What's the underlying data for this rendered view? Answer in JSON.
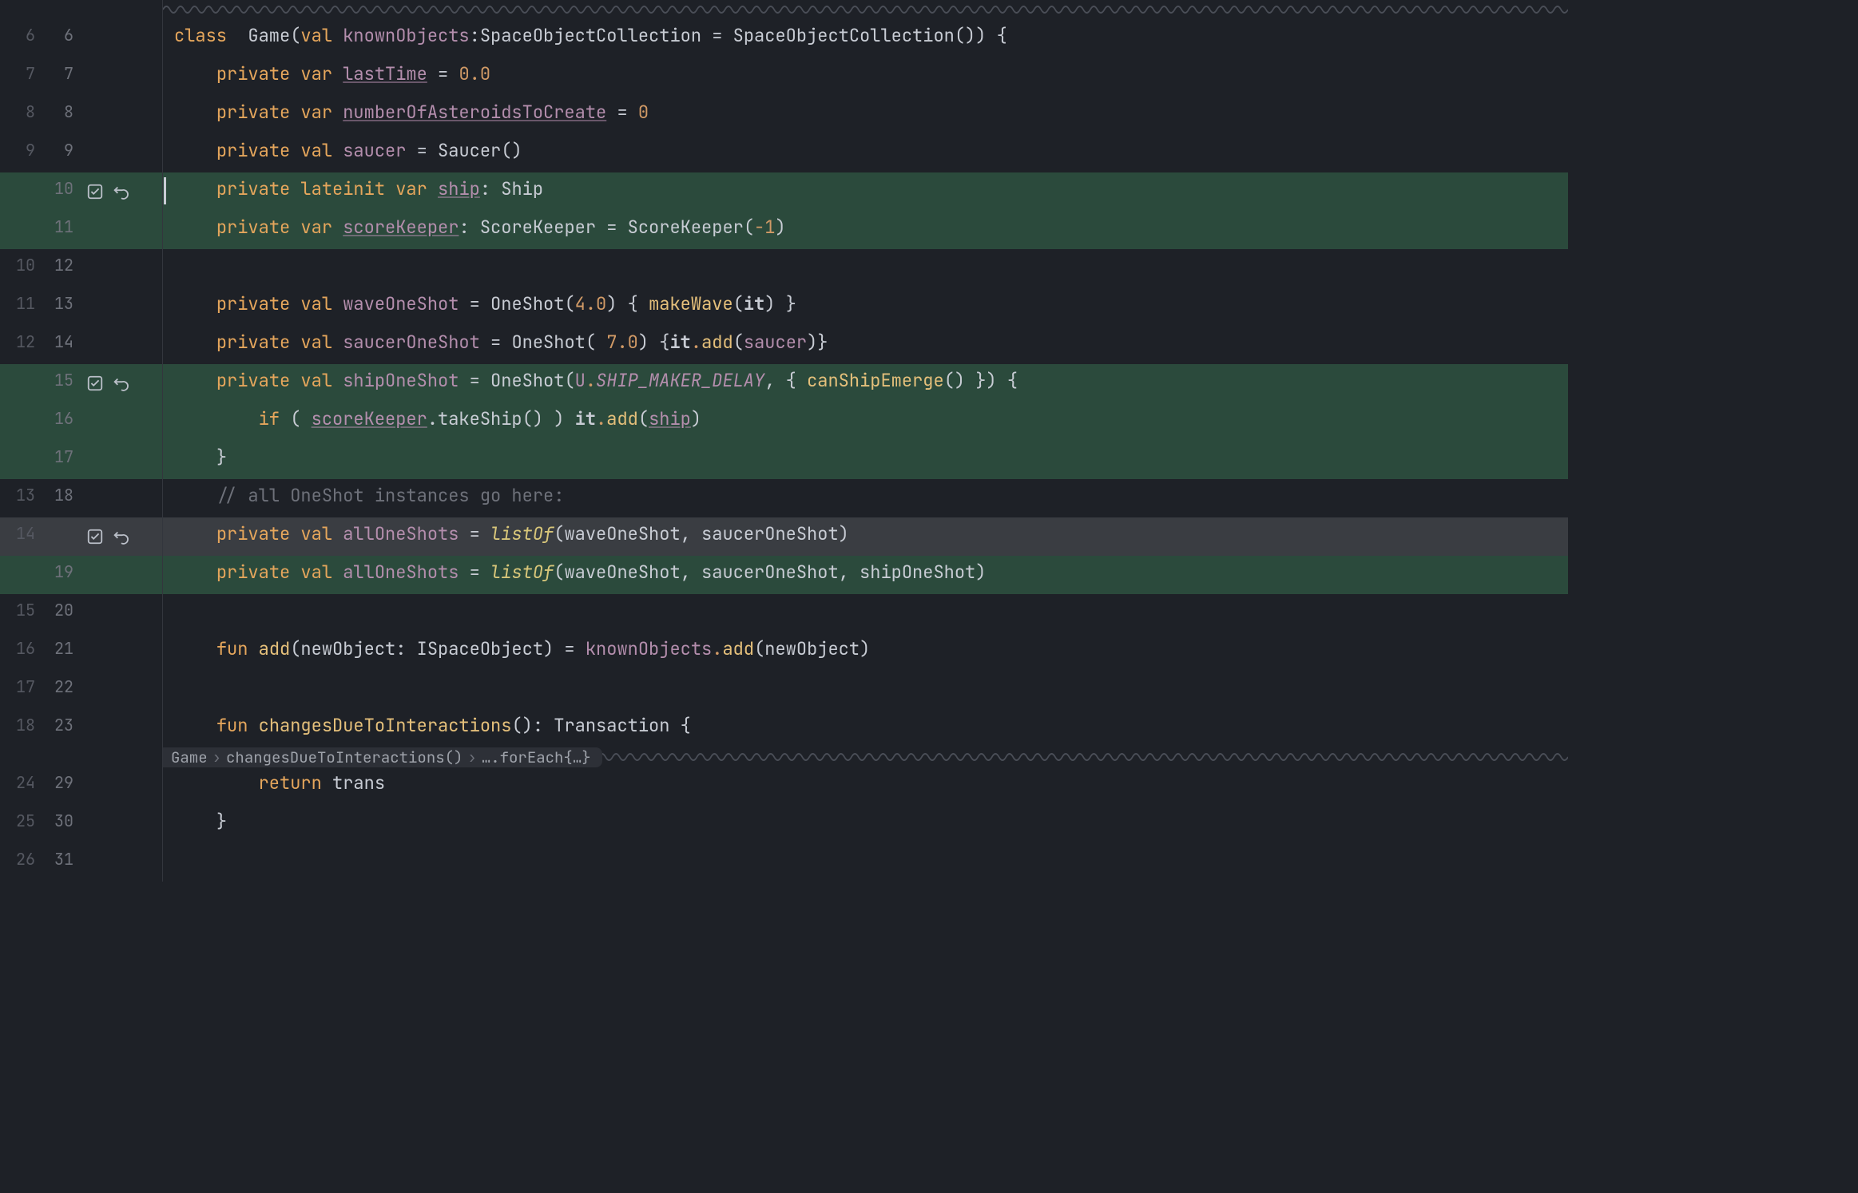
{
  "rows": [
    {
      "a": "6",
      "b": "6",
      "cls": "",
      "tokens": [
        "class ",
        " ",
        "Game",
        "(",
        "val",
        " ",
        "knownObjects",
        ":",
        "SpaceObjectCollection",
        " = ",
        "SpaceObjectCollection",
        "()",
        ") {"
      ]
    },
    {
      "a": "7",
      "b": "7",
      "cls": "",
      "tokens": [
        "    ",
        "private",
        " ",
        "var",
        " ",
        "lastTime",
        " = ",
        "0.0"
      ]
    },
    {
      "a": "8",
      "b": "8",
      "cls": "",
      "tokens": [
        "    ",
        "private",
        " ",
        "var",
        " ",
        "numberOfAsteroidsToCreate",
        " = ",
        "0"
      ]
    },
    {
      "a": "9",
      "b": "9",
      "cls": "",
      "tokens": [
        "    ",
        "private",
        " ",
        "val",
        " ",
        "saucer",
        " = Saucer()"
      ]
    },
    {
      "a": "",
      "b": "10",
      "cls": "green",
      "icons": true,
      "caret": true,
      "tokens": [
        "    ",
        "private",
        " ",
        "lateinit",
        " ",
        "var",
        " ",
        "ship",
        ": Ship"
      ]
    },
    {
      "a": "",
      "b": "11",
      "cls": "green",
      "tokens": [
        "    ",
        "private",
        " ",
        "var",
        " ",
        "scoreKeeper",
        ": ScoreKeeper = ScoreKeeper(",
        "-1",
        ")"
      ]
    },
    {
      "a": "10",
      "b": "12",
      "cls": "",
      "tokens": [
        ""
      ]
    },
    {
      "a": "11",
      "b": "13",
      "cls": "",
      "tokens": [
        "    ",
        "private",
        " ",
        "val",
        " ",
        "waveOneShot",
        " = OneShot(",
        "4.0",
        ") { ",
        "makeWave",
        "(",
        "it",
        ") ",
        "}"
      ]
    },
    {
      "a": "12",
      "b": "14",
      "cls": "",
      "tokens": [
        "    ",
        "private",
        " ",
        "val",
        " ",
        "saucerOneShot",
        " = OneShot( ",
        "7.0",
        ") {",
        "it",
        ".",
        "add",
        "(",
        "saucer",
        ")",
        "}"
      ]
    },
    {
      "a": "",
      "b": "15",
      "cls": "green",
      "icons": true,
      "tokens": [
        "    ",
        "private",
        " ",
        "val",
        " ",
        "shipOneShot",
        " = OneShot(",
        "U",
        ".",
        "SHIP_MAKER_DELAY",
        ", { ",
        "canShipEmerge",
        "() }) {"
      ]
    },
    {
      "a": "",
      "b": "16",
      "cls": "green",
      "tokens": [
        "        ",
        "if",
        " ( ",
        "scoreKeeper",
        ".takeShip() ) ",
        "it",
        ".",
        "add",
        "(",
        "ship",
        ")"
      ]
    },
    {
      "a": "",
      "b": "17",
      "cls": "green",
      "tokens": [
        "    ",
        "}"
      ]
    },
    {
      "a": "13",
      "b": "18",
      "cls": "",
      "tokens": [
        "    ",
        "// all OneShot instances go here:"
      ]
    },
    {
      "a": "14",
      "b": "",
      "cls": "gray",
      "icons": true,
      "tokens": [
        "    ",
        "private",
        " ",
        "val",
        " ",
        "allOneShots",
        " = ",
        "listOf",
        "(waveOneShot, saucerOneShot)"
      ]
    },
    {
      "a": "",
      "b": "19",
      "cls": "green",
      "tokens": [
        "    ",
        "private",
        " ",
        "val",
        " ",
        "allOneShots",
        " = ",
        "listOf",
        "(waveOneShot, saucerOneShot, shipOneShot)"
      ]
    },
    {
      "a": "15",
      "b": "20",
      "cls": "",
      "tokens": [
        ""
      ]
    },
    {
      "a": "16",
      "b": "21",
      "cls": "",
      "tokens": [
        "    ",
        "fun",
        " ",
        "add",
        "(newObject: ISpaceObject) = ",
        "knownObjects",
        ".",
        "add",
        "(newObject)"
      ]
    },
    {
      "a": "17",
      "b": "22",
      "cls": "",
      "tokens": [
        ""
      ]
    },
    {
      "a": "18",
      "b": "23",
      "cls": "",
      "tokens": [
        "    ",
        "fun",
        " ",
        "changesDueToInteractions",
        "(): Transaction {"
      ]
    }
  ],
  "breadcrumb": {
    "segments": [
      "Game",
      "changesDueToInteractions()",
      "….forEach{…}"
    ]
  },
  "rows2": [
    {
      "a": "24",
      "b": "29",
      "cls": "",
      "tokens": [
        "        ",
        "return",
        " trans"
      ]
    },
    {
      "a": "25",
      "b": "30",
      "cls": "",
      "tokens": [
        "    ",
        "}"
      ]
    },
    {
      "a": "26",
      "b": "31",
      "cls": "",
      "tokens": [
        ""
      ]
    }
  ],
  "icons": {
    "accept": "accept-icon",
    "revert": "revert-icon"
  }
}
